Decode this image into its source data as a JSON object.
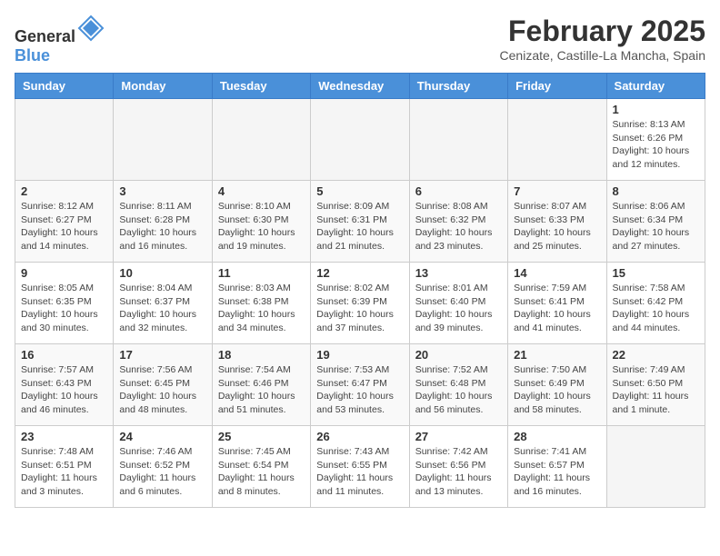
{
  "header": {
    "logo_general": "General",
    "logo_blue": "Blue",
    "month_title": "February 2025",
    "location": "Cenizate, Castille-La Mancha, Spain"
  },
  "days_of_week": [
    "Sunday",
    "Monday",
    "Tuesday",
    "Wednesday",
    "Thursday",
    "Friday",
    "Saturday"
  ],
  "weeks": [
    [
      {
        "day": "",
        "info": ""
      },
      {
        "day": "",
        "info": ""
      },
      {
        "day": "",
        "info": ""
      },
      {
        "day": "",
        "info": ""
      },
      {
        "day": "",
        "info": ""
      },
      {
        "day": "",
        "info": ""
      },
      {
        "day": "1",
        "info": "Sunrise: 8:13 AM\nSunset: 6:26 PM\nDaylight: 10 hours and 12 minutes."
      }
    ],
    [
      {
        "day": "2",
        "info": "Sunrise: 8:12 AM\nSunset: 6:27 PM\nDaylight: 10 hours and 14 minutes."
      },
      {
        "day": "3",
        "info": "Sunrise: 8:11 AM\nSunset: 6:28 PM\nDaylight: 10 hours and 16 minutes."
      },
      {
        "day": "4",
        "info": "Sunrise: 8:10 AM\nSunset: 6:30 PM\nDaylight: 10 hours and 19 minutes."
      },
      {
        "day": "5",
        "info": "Sunrise: 8:09 AM\nSunset: 6:31 PM\nDaylight: 10 hours and 21 minutes."
      },
      {
        "day": "6",
        "info": "Sunrise: 8:08 AM\nSunset: 6:32 PM\nDaylight: 10 hours and 23 minutes."
      },
      {
        "day": "7",
        "info": "Sunrise: 8:07 AM\nSunset: 6:33 PM\nDaylight: 10 hours and 25 minutes."
      },
      {
        "day": "8",
        "info": "Sunrise: 8:06 AM\nSunset: 6:34 PM\nDaylight: 10 hours and 27 minutes."
      }
    ],
    [
      {
        "day": "9",
        "info": "Sunrise: 8:05 AM\nSunset: 6:35 PM\nDaylight: 10 hours and 30 minutes."
      },
      {
        "day": "10",
        "info": "Sunrise: 8:04 AM\nSunset: 6:37 PM\nDaylight: 10 hours and 32 minutes."
      },
      {
        "day": "11",
        "info": "Sunrise: 8:03 AM\nSunset: 6:38 PM\nDaylight: 10 hours and 34 minutes."
      },
      {
        "day": "12",
        "info": "Sunrise: 8:02 AM\nSunset: 6:39 PM\nDaylight: 10 hours and 37 minutes."
      },
      {
        "day": "13",
        "info": "Sunrise: 8:01 AM\nSunset: 6:40 PM\nDaylight: 10 hours and 39 minutes."
      },
      {
        "day": "14",
        "info": "Sunrise: 7:59 AM\nSunset: 6:41 PM\nDaylight: 10 hours and 41 minutes."
      },
      {
        "day": "15",
        "info": "Sunrise: 7:58 AM\nSunset: 6:42 PM\nDaylight: 10 hours and 44 minutes."
      }
    ],
    [
      {
        "day": "16",
        "info": "Sunrise: 7:57 AM\nSunset: 6:43 PM\nDaylight: 10 hours and 46 minutes."
      },
      {
        "day": "17",
        "info": "Sunrise: 7:56 AM\nSunset: 6:45 PM\nDaylight: 10 hours and 48 minutes."
      },
      {
        "day": "18",
        "info": "Sunrise: 7:54 AM\nSunset: 6:46 PM\nDaylight: 10 hours and 51 minutes."
      },
      {
        "day": "19",
        "info": "Sunrise: 7:53 AM\nSunset: 6:47 PM\nDaylight: 10 hours and 53 minutes."
      },
      {
        "day": "20",
        "info": "Sunrise: 7:52 AM\nSunset: 6:48 PM\nDaylight: 10 hours and 56 minutes."
      },
      {
        "day": "21",
        "info": "Sunrise: 7:50 AM\nSunset: 6:49 PM\nDaylight: 10 hours and 58 minutes."
      },
      {
        "day": "22",
        "info": "Sunrise: 7:49 AM\nSunset: 6:50 PM\nDaylight: 11 hours and 1 minute."
      }
    ],
    [
      {
        "day": "23",
        "info": "Sunrise: 7:48 AM\nSunset: 6:51 PM\nDaylight: 11 hours and 3 minutes."
      },
      {
        "day": "24",
        "info": "Sunrise: 7:46 AM\nSunset: 6:52 PM\nDaylight: 11 hours and 6 minutes."
      },
      {
        "day": "25",
        "info": "Sunrise: 7:45 AM\nSunset: 6:54 PM\nDaylight: 11 hours and 8 minutes."
      },
      {
        "day": "26",
        "info": "Sunrise: 7:43 AM\nSunset: 6:55 PM\nDaylight: 11 hours and 11 minutes."
      },
      {
        "day": "27",
        "info": "Sunrise: 7:42 AM\nSunset: 6:56 PM\nDaylight: 11 hours and 13 minutes."
      },
      {
        "day": "28",
        "info": "Sunrise: 7:41 AM\nSunset: 6:57 PM\nDaylight: 11 hours and 16 minutes."
      },
      {
        "day": "",
        "info": ""
      }
    ]
  ]
}
